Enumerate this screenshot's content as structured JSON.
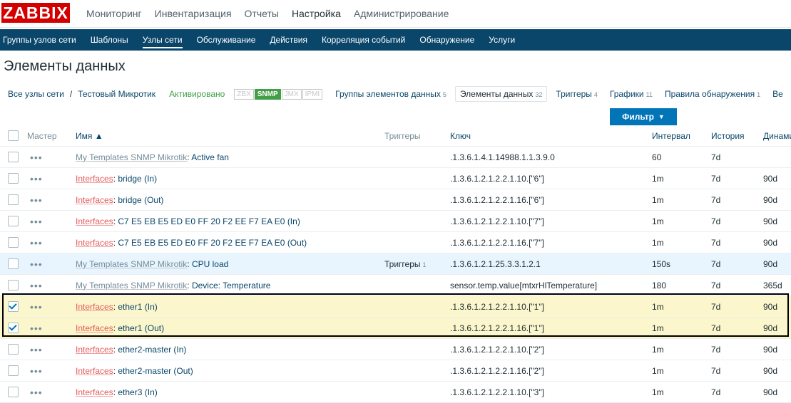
{
  "logo": "ZABBIX",
  "top_nav": [
    "Мониторинг",
    "Инвентаризация",
    "Отчеты",
    "Настройка",
    "Администрирование"
  ],
  "sub_nav": [
    "Группы узлов сети",
    "Шаблоны",
    "Узлы сети",
    "Обслуживание",
    "Действия",
    "Корреляция событий",
    "Обнаружение",
    "Услуги"
  ],
  "page_title": "Элементы данных",
  "breadcrumb": {
    "all_hosts": "Все узлы сети",
    "separator": "/",
    "host": "Тестовый Микротик",
    "status": "Активировано",
    "interfaces": [
      "ZBX",
      "SNMP",
      "JMX",
      "IPMI"
    ],
    "items": [
      {
        "label": "Группы элементов данных",
        "count": "5"
      },
      {
        "label": "Элементы данных",
        "count": "32"
      },
      {
        "label": "Триггеры",
        "count": "4"
      },
      {
        "label": "Графики",
        "count": "11"
      },
      {
        "label": "Правила обнаружения",
        "count": "1"
      },
      {
        "label": "Ве",
        "count": ""
      }
    ]
  },
  "filter_label": "Фильтр",
  "filter_arrow": "▼",
  "table": {
    "headers": [
      "Мастер",
      "Имя ▲",
      "Триггеры",
      "Ключ",
      "Интервал",
      "История",
      "Динами"
    ],
    "rows": [
      {
        "prefix": "My Templates SNMP Mikrotik",
        "name": "Active fan",
        "triggers": "",
        "triggers_count": "",
        "key": ".1.3.6.1.4.1.14988.1.1.3.9.0",
        "interval": "60",
        "history": "7d",
        "trends": ""
      },
      {
        "prefix": "Interfaces",
        "name": "bridge (In)",
        "triggers": "",
        "triggers_count": "",
        "key": ".1.3.6.1.2.1.2.2.1.10.[\"6\"]",
        "interval": "1m",
        "history": "7d",
        "trends": "90d"
      },
      {
        "prefix": "Interfaces",
        "name": "bridge (Out)",
        "triggers": "",
        "triggers_count": "",
        "key": ".1.3.6.1.2.1.2.2.1.16.[\"6\"]",
        "interval": "1m",
        "history": "7d",
        "trends": "90d"
      },
      {
        "prefix": "Interfaces",
        "name": "C7 E5 EB E5 ED E0 FF 20 F2 EE F7 EA E0 (In)",
        "triggers": "",
        "triggers_count": "",
        "key": ".1.3.6.1.2.1.2.2.1.10.[\"7\"]",
        "interval": "1m",
        "history": "7d",
        "trends": "90d"
      },
      {
        "prefix": "Interfaces",
        "name": "C7 E5 EB E5 ED E0 FF 20 F2 EE F7 EA E0 (Out)",
        "triggers": "",
        "triggers_count": "",
        "key": ".1.3.6.1.2.1.2.2.1.16.[\"7\"]",
        "interval": "1m",
        "history": "7d",
        "trends": "90d"
      },
      {
        "prefix": "My Templates SNMP Mikrotik",
        "name": "CPU load",
        "triggers": "Триггеры",
        "triggers_count": "1",
        "key": ".1.3.6.1.2.1.25.3.3.1.2.1",
        "interval": "150s",
        "history": "7d",
        "trends": "90d"
      },
      {
        "prefix": "My Templates SNMP Mikrotik",
        "name": "Device: Temperature",
        "triggers": "",
        "triggers_count": "",
        "key": "sensor.temp.value[mtxrHlTemperature]",
        "interval": "180",
        "history": "7d",
        "trends": "365d"
      },
      {
        "prefix": "Interfaces",
        "name": "ether1 (In)",
        "triggers": "",
        "triggers_count": "",
        "key": ".1.3.6.1.2.1.2.2.1.10.[\"1\"]",
        "interval": "1m",
        "history": "7d",
        "trends": "90d"
      },
      {
        "prefix": "Interfaces",
        "name": "ether1 (Out)",
        "triggers": "",
        "triggers_count": "",
        "key": ".1.3.6.1.2.1.2.2.1.16.[\"1\"]",
        "interval": "1m",
        "history": "7d",
        "trends": "90d"
      },
      {
        "prefix": "Interfaces",
        "name": "ether2-master (In)",
        "triggers": "",
        "triggers_count": "",
        "key": ".1.3.6.1.2.1.2.2.1.10.[\"2\"]",
        "interval": "1m",
        "history": "7d",
        "trends": "90d"
      },
      {
        "prefix": "Interfaces",
        "name": "ether2-master (Out)",
        "triggers": "",
        "triggers_count": "",
        "key": ".1.3.6.1.2.1.2.2.1.16.[\"2\"]",
        "interval": "1m",
        "history": "7d",
        "trends": "90d"
      },
      {
        "prefix": "Interfaces",
        "name": "ether3 (In)",
        "triggers": "",
        "triggers_count": "",
        "key": ".1.3.6.1.2.1.2.2.1.10.[\"3\"]",
        "interval": "1m",
        "history": "7d",
        "trends": "90d"
      }
    ]
  }
}
